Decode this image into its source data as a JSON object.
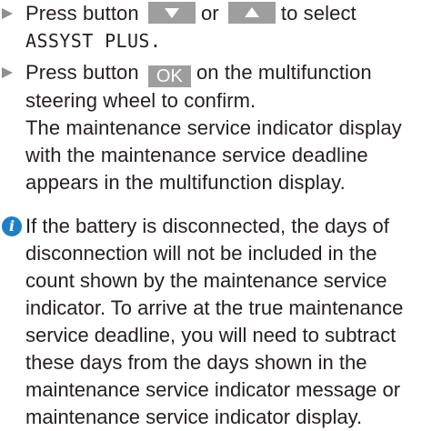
{
  "steps": [
    {
      "prefix": "Press button",
      "button_down": "down-arrow",
      "or": "or",
      "button_up": "up-arrow",
      "suffix": "to select",
      "menu_item": "ASSYST PLUS."
    },
    {
      "prefix": "Press button",
      "button_ok": "OK",
      "suffix": "on the multifunction steering wheel to confirm.",
      "result": "The maintenance service indicator display with the maintenance service deadline appears in the multifunction display."
    }
  ],
  "note": {
    "icon": "info-icon",
    "text": "If the battery is disconnected, the days of disconnection will not be included in the count shown by the maintenance service indicator. To arrive at the true maintenance service deadline, you will need to subtract these days from the days shown in the maintenance service indicator message or maintenance service indicator display."
  },
  "colors": {
    "text": "#231f20",
    "button_bg": "#9e9e9e",
    "bullet": "#8f8f8f",
    "info_icon": "#1d7fc7"
  }
}
